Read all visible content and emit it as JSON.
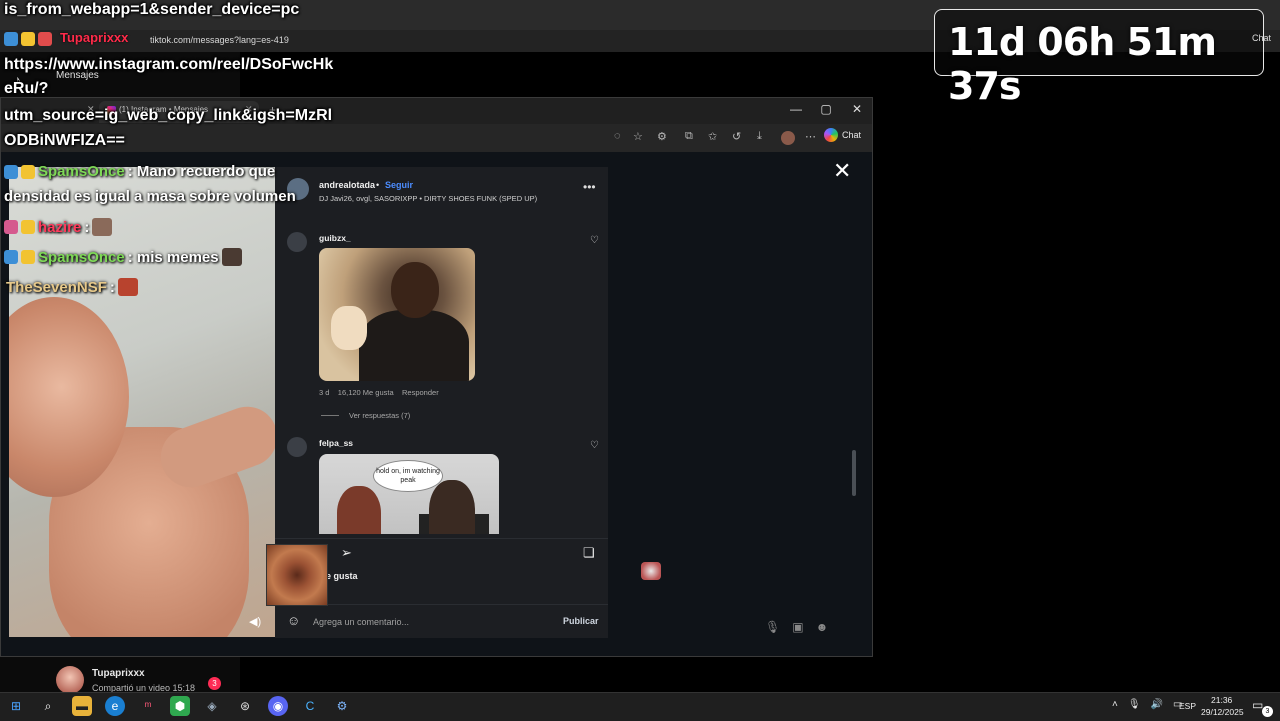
{
  "stream_overlay": {
    "link_lines": [
      "is_from_webapp=1&sender_device=pc",
      "https://www.instagram.com/reel/DSoFwcHk",
      "eRu/?",
      "utm_source=ig_web_copy_link&igsh=MzRl",
      "ODBiNWFIZA=="
    ],
    "chat": [
      {
        "user": "SpamsOnce",
        "message": ": Mano recuerdo que",
        "color": "#7ed957"
      },
      {
        "continuation": "densidad es igual a masa sobre volumen"
      },
      {
        "user": "hazire",
        "message": ":",
        "color": "#ff3b5c"
      },
      {
        "user": "SpamsOnce",
        "message": ": mis memes",
        "color": "#7ed957"
      },
      {
        "user": "TheSevenNSF",
        "message": ":",
        "color": "#e7c98a"
      }
    ],
    "timer": "11d 06h 51m 37s"
  },
  "background_browser": {
    "tab_name": "Tupaprixxx",
    "url": "tiktok.com/messages?lang=es-419",
    "page_label": "Mensajes",
    "chat_label": "Chat",
    "notification": {
      "user": "Tupaprixxx",
      "text": "Compartió un video 15:18",
      "badge": "3"
    }
  },
  "edge_window": {
    "tab_title": "(1) Instagram • Mensajes",
    "chat_button": "Chat",
    "controls": {
      "minimize": "—",
      "maximize": "▢",
      "close": "✕"
    }
  },
  "post": {
    "username": "andrealotada",
    "separator": "•",
    "follow_label": "Seguir",
    "audio": "DJ Javi26, ovgl, SASORIXPP • DIRTY SHOES FUNK (SPED UP)",
    "likes_fragment": "e gusta",
    "comment_placeholder": "Agrega un comentario...",
    "publish_label": "Publicar",
    "comments": [
      {
        "user": "guibzx_",
        "age": "3 d",
        "likes": "16,120 Me gusta",
        "reply": "Responder",
        "view_replies": "Ver respuestas (7)"
      },
      {
        "user": "felpa_ss",
        "image_caption": "hold on, im watching peak"
      }
    ]
  },
  "taskbar": {
    "lang": "ESP",
    "time": "21:36",
    "date": "29/12/2025",
    "notification_count": "3"
  }
}
